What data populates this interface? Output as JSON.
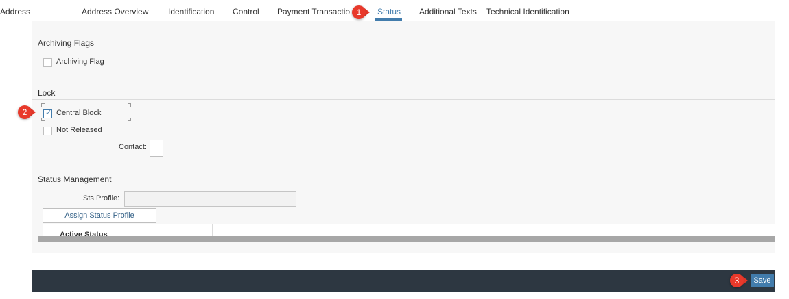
{
  "tabs": [
    {
      "label": "Address"
    },
    {
      "label": "Address Overview"
    },
    {
      "label": "Identification"
    },
    {
      "label": "Control"
    },
    {
      "label": "Payment Transactio"
    },
    {
      "label": "Status"
    },
    {
      "label": "Additional Texts"
    },
    {
      "label": "Technical Identification"
    }
  ],
  "active_tab": "Status",
  "archiving": {
    "title": "Archiving Flags",
    "flag_label": "Archiving Flag",
    "flag_checked": false
  },
  "lock": {
    "title": "Lock",
    "central_block_label": "Central Block",
    "central_block_checked": true,
    "not_released_label": "Not Released",
    "not_released_checked": false,
    "contact_label": "Contact:",
    "contact_value": ""
  },
  "status_management": {
    "title": "Status Management",
    "sts_profile_label": "Sts Profile:",
    "sts_profile_value": "",
    "assign_button_label": "Assign Status Profile",
    "table_headers": [
      "Active Status"
    ]
  },
  "footer": {
    "save_label": "Save"
  },
  "markers": [
    "1",
    "2",
    "3"
  ],
  "colors": {
    "accent": "#427cac",
    "footer_bg": "#2d3741",
    "marker": "#e8392b",
    "content_bg": "#f7f7f7"
  }
}
